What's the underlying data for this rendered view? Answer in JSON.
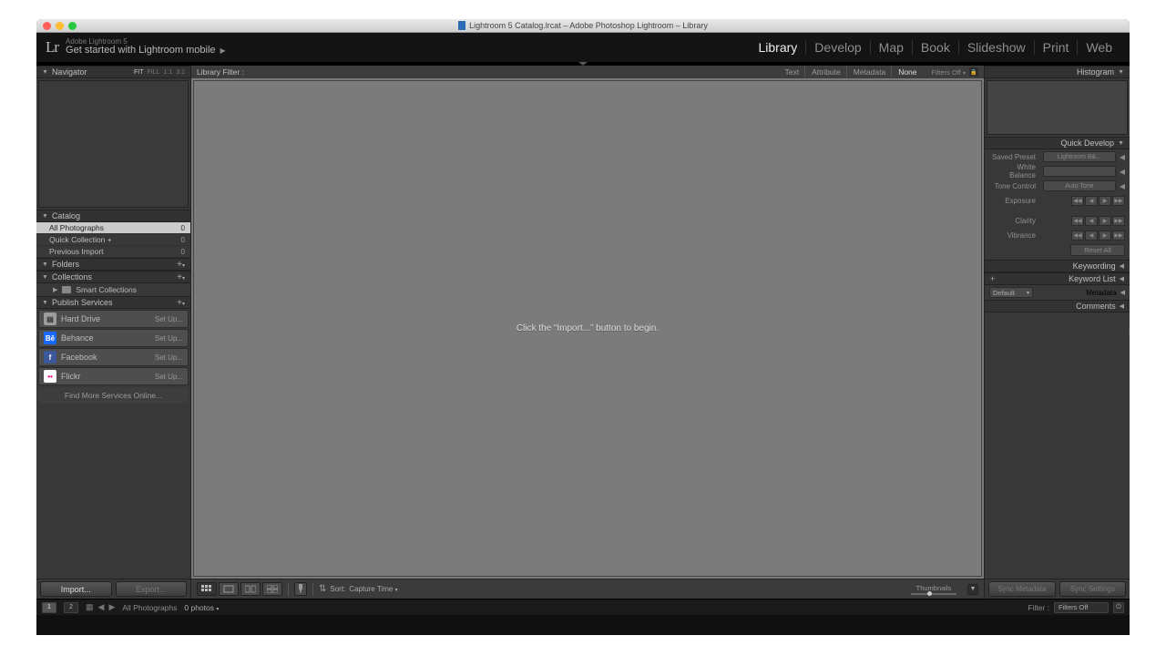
{
  "titlebar": {
    "title": "Lightroom 5 Catalog.lrcat – Adobe Photoshop Lightroom – Library"
  },
  "identity": {
    "product": "Adobe Lightroom 5",
    "tagline": "Get started with Lightroom mobile",
    "logo": "Lr"
  },
  "modules": [
    "Library",
    "Develop",
    "Map",
    "Book",
    "Slideshow",
    "Print",
    "Web"
  ],
  "active_module": "Library",
  "left": {
    "navigator": {
      "title": "Navigator",
      "zoom": [
        "FIT",
        "FILL",
        "1:1",
        "3:1"
      ]
    },
    "catalog": {
      "title": "Catalog",
      "items": [
        {
          "label": "All Photographs",
          "count": "0",
          "selected": true
        },
        {
          "label": "Quick Collection  +",
          "count": "0"
        },
        {
          "label": "Previous Import",
          "count": "0"
        }
      ]
    },
    "folders": {
      "title": "Folders"
    },
    "collections": {
      "title": "Collections",
      "smart": "Smart Collections"
    },
    "publish": {
      "title": "Publish Services",
      "services": [
        {
          "name": "Hard Drive",
          "icon": "hdd",
          "bg": "#9c9c9c",
          "color": "#333",
          "glyph": "▤"
        },
        {
          "name": "Behance",
          "icon": "behance",
          "bg": "#1769ff",
          "color": "#fff",
          "glyph": "Bē"
        },
        {
          "name": "Facebook",
          "icon": "facebook",
          "bg": "#3b5998",
          "color": "#fff",
          "glyph": "f"
        },
        {
          "name": "Flickr",
          "icon": "flickr",
          "bg": "#ffffff",
          "color": "#ff0084",
          "glyph": "••"
        }
      ],
      "setup": "Set Up...",
      "findmore": "Find More Services Online..."
    },
    "buttons": {
      "import": "Import...",
      "export": "Export..."
    }
  },
  "center": {
    "filterbar": {
      "label": "Library Filter :",
      "tabs": [
        "Text",
        "Attribute",
        "Metadata",
        "None"
      ],
      "active": "None",
      "filters_off": "Filters Off"
    },
    "empty_msg": "Click the “Import...” button to begin.",
    "toolbar": {
      "sort_label": "Sort:",
      "sort_value": "Capture Time",
      "thumb_label": "Thumbnails"
    }
  },
  "right": {
    "histogram": "Histogram",
    "quickdev": {
      "title": "Quick Develop",
      "rows": {
        "preset": {
          "label": "Saved Preset",
          "value": "Lightroom B&..."
        },
        "wb": {
          "label": "White Balance",
          "value": ""
        },
        "tone": {
          "label": "Tone Control",
          "value": "Auto Tone"
        },
        "exposure": "Exposure",
        "clarity": "Clarity",
        "vibrance": "Vibrance"
      },
      "reset": "Reset All"
    },
    "keywording": "Keywording",
    "keywordlist": "Keyword List",
    "metadata": {
      "title": "Metadata",
      "preset": "Default"
    },
    "comments": "Comments",
    "buttons": {
      "syncmeta": "Sync Metadata",
      "syncset": "Sync Settings"
    }
  },
  "filmstrip": {
    "screens": [
      "1",
      "2"
    ],
    "breadcrumb": "All Photographs",
    "count": "0 photos",
    "filter_label": "Filter :",
    "filter_value": "Filters Off"
  }
}
